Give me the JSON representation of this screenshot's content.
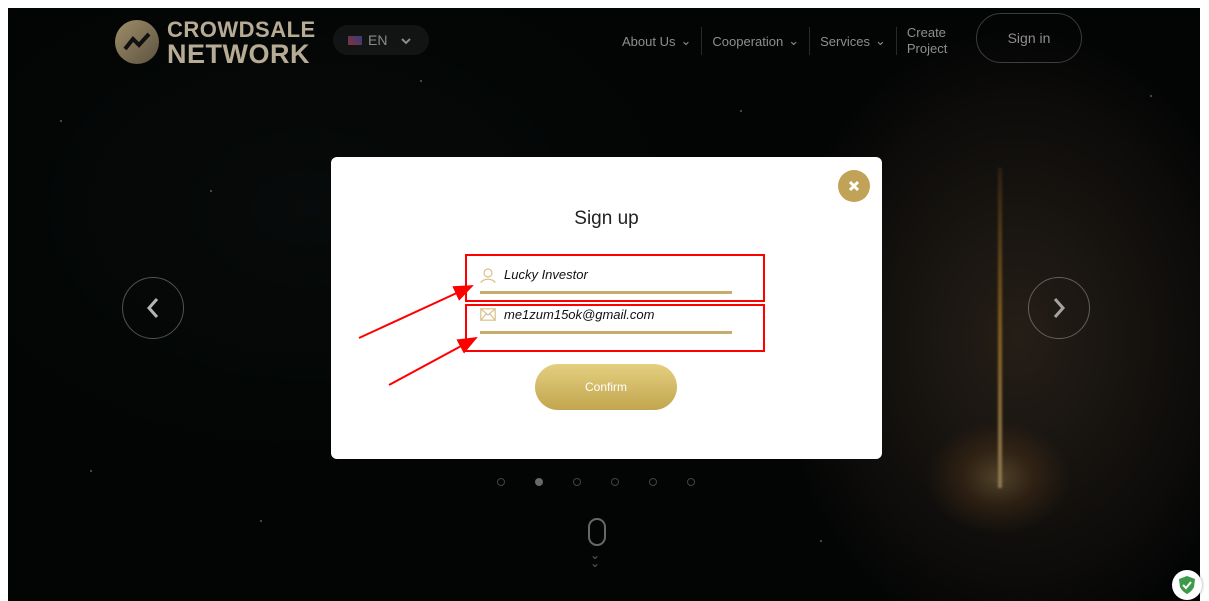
{
  "header": {
    "logo_line1": "CROWDSALE",
    "logo_line2": "NETWORK",
    "language": "EN",
    "nav": [
      {
        "label": "About Us"
      },
      {
        "label": "Cooperation"
      },
      {
        "label": "Services"
      }
    ],
    "create_line1": "Create",
    "create_line2": "Project",
    "signin_label": "Sign in"
  },
  "modal": {
    "title": "Sign up",
    "name_value": "Lucky Investor",
    "email_value": "me1zum15ok@gmail.com",
    "confirm_label": "Confirm"
  },
  "slider": {
    "dot_count": 6,
    "active_index": 1
  },
  "colors": {
    "accent": "#c1a358",
    "annotation": "#ff0000"
  }
}
